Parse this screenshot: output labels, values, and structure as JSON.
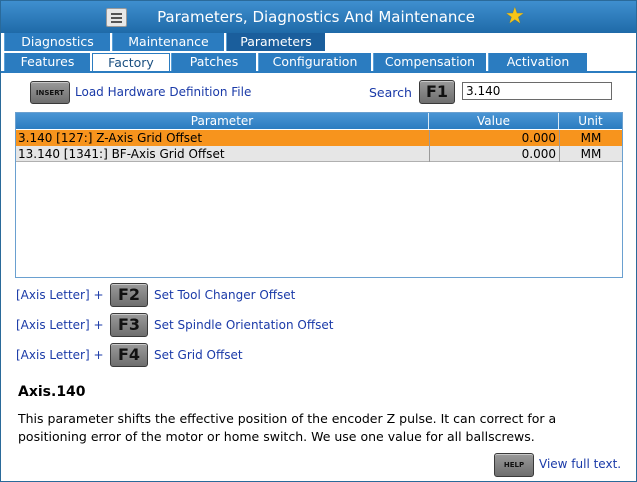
{
  "window": {
    "title": "Parameters, Diagnostics And Maintenance",
    "menu_icon": "hamburger-icon",
    "star_icon": "star-icon",
    "star_color": "#f5c518"
  },
  "tabs_top": [
    {
      "label": "Diagnostics",
      "active": false
    },
    {
      "label": "Maintenance",
      "active": false
    },
    {
      "label": "Parameters",
      "active": true
    }
  ],
  "tabs_sub": [
    {
      "label": "Features",
      "active": false
    },
    {
      "label": "Factory",
      "active": true
    },
    {
      "label": "Patches",
      "active": false
    },
    {
      "label": "Configuration",
      "active": false
    },
    {
      "label": "Compensation",
      "active": false
    },
    {
      "label": "Activation",
      "active": false
    }
  ],
  "toolbar": {
    "insert_key": "INSERT",
    "load_label": "Load Hardware Definition File",
    "search_label": "Search",
    "search_key": "F1",
    "search_value": "3.140"
  },
  "table": {
    "columns": [
      "Parameter",
      "Value",
      "Unit"
    ],
    "rows": [
      {
        "parameter": "3.140 [127:] Z-Axis Grid Offset",
        "value": "0.000",
        "unit": "MM",
        "selected": true
      },
      {
        "parameter": "13.140 [1341:] BF-Axis Grid Offset",
        "value": "0.000",
        "unit": "MM",
        "selected": false
      }
    ],
    "selected_color": "#f7941d"
  },
  "shortcuts": [
    {
      "prefix": "[Axis Letter]  +",
      "key": "F2",
      "label": "Set Tool Changer Offset"
    },
    {
      "prefix": "[Axis Letter]  +",
      "key": "F3",
      "label": "Set Spindle Orientation Offset"
    },
    {
      "prefix": "[Axis Letter]  +",
      "key": "F4",
      "label": "Set Grid Offset"
    }
  ],
  "help": {
    "title": "Axis.140",
    "body": "This parameter shifts the effective position of the encoder Z pulse. It can correct for a positioning error of the motor or home switch. We use one value for all ballscrews.",
    "help_key": "HELP",
    "view_label": "View full text."
  },
  "colors": {
    "accent": "#2b7cc0",
    "link": "#1a3aa8"
  }
}
